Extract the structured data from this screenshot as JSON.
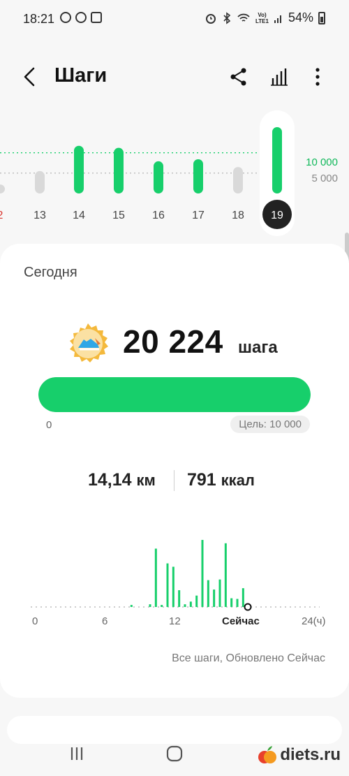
{
  "status_bar": {
    "time": "18:21",
    "network_label": "Vo)\nLTE1",
    "battery": "54%"
  },
  "header": {
    "title": "Шаги",
    "icons": [
      "back-arrow-icon",
      "share-icon",
      "bar-chart-icon",
      "more-vert-icon"
    ]
  },
  "weekly": {
    "goal_label": "10 000",
    "half_label": "5 000",
    "days": [
      {
        "label": "2",
        "steps": 2200,
        "color": "#d9d9d9",
        "label_color": "#d9362f"
      },
      {
        "label": "13",
        "steps": 5500,
        "color": "#d9d9d9",
        "label_color": "#444444"
      },
      {
        "label": "14",
        "steps": 11700,
        "color": "#17cf6b",
        "label_color": "#444444"
      },
      {
        "label": "15",
        "steps": 11200,
        "color": "#17cf6b",
        "label_color": "#444444"
      },
      {
        "label": "16",
        "steps": 7900,
        "color": "#17cf6b",
        "label_color": "#444444"
      },
      {
        "label": "17",
        "steps": 8400,
        "color": "#17cf6b",
        "label_color": "#444444"
      },
      {
        "label": "18",
        "steps": 6500,
        "color": "#d9d9d9",
        "label_color": "#444444"
      },
      {
        "label": "19",
        "steps": 20224,
        "color": "#17cf6b",
        "label_color": "#ffffff",
        "selected": true
      }
    ]
  },
  "today": {
    "heading": "Сегодня",
    "steps": "20 224",
    "steps_unit": "шага",
    "progress_fraction": 1.0,
    "progress_zero": "0",
    "goal_text": "Цель: 10 000",
    "distance_value": "14,14",
    "distance_unit": "км",
    "calories_value": "791",
    "calories_unit": "ккал",
    "updated_text": "Все шаги, Обновлено Сейчас"
  },
  "hourly_chart": {
    "x_labels": [
      "0",
      "6",
      "12",
      "Сейчас",
      "24(ч)"
    ],
    "bars": [
      {
        "hour": 8.3,
        "value": 3
      },
      {
        "hour": 9.9,
        "value": 4
      },
      {
        "hour": 10.4,
        "value": 87
      },
      {
        "hour": 10.9,
        "value": 3
      },
      {
        "hour": 11.4,
        "value": 65
      },
      {
        "hour": 11.9,
        "value": 60
      },
      {
        "hour": 12.4,
        "value": 25
      },
      {
        "hour": 12.9,
        "value": 4
      },
      {
        "hour": 13.4,
        "value": 8
      },
      {
        "hour": 13.9,
        "value": 17
      },
      {
        "hour": 14.4,
        "value": 100
      },
      {
        "hour": 14.9,
        "value": 40
      },
      {
        "hour": 15.4,
        "value": 26
      },
      {
        "hour": 15.9,
        "value": 41
      },
      {
        "hour": 16.4,
        "value": 95
      },
      {
        "hour": 16.9,
        "value": 13
      },
      {
        "hour": 17.4,
        "value": 12
      },
      {
        "hour": 17.9,
        "value": 28
      }
    ],
    "now_hour": 18.3,
    "bar_color": "#17cf6b"
  },
  "nav_bar": {
    "icons": [
      "recent-apps-icon",
      "home-icon"
    ]
  },
  "watermark": {
    "text": "diets.ru"
  }
}
